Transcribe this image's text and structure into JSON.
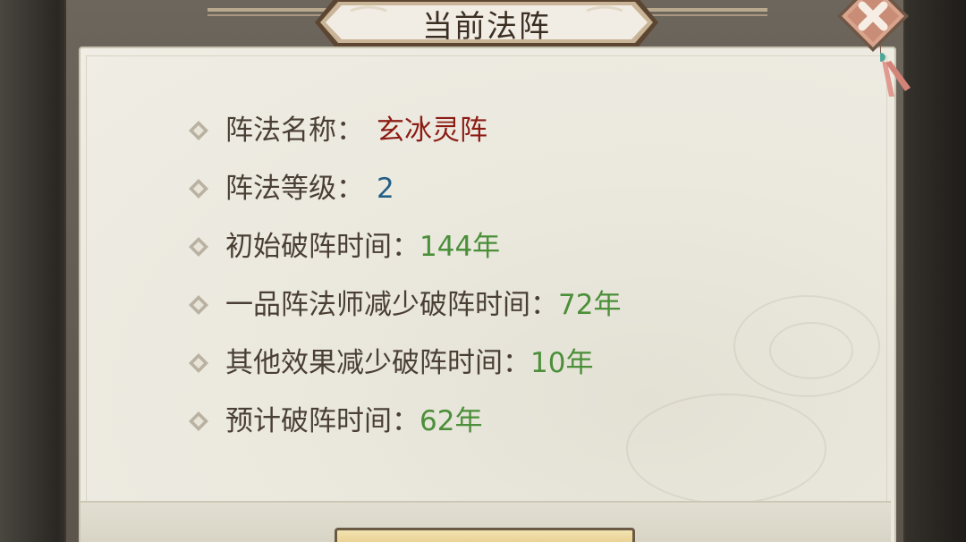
{
  "dialog": {
    "title": "当前法阵",
    "close_icon": "close-icon"
  },
  "info": {
    "formation_name_label": "阵法名称：",
    "formation_name_value": "玄冰灵阵",
    "formation_level_label": "阵法等级：",
    "formation_level_value": "2",
    "initial_break_time_label": "初始破阵时间：",
    "initial_break_time_value": "144年",
    "master_reduction_label": "一品阵法师减少破阵时间：",
    "master_reduction_value": "72年",
    "other_reduction_label": "其他效果减少破阵时间：",
    "other_reduction_value": "10年",
    "estimated_break_time_label": "预计破阵时间：",
    "estimated_break_time_value": "62年"
  },
  "colors": {
    "name_value": "#8c1c14",
    "level_value": "#235f86",
    "time_values": "#4b8f3a",
    "label_text": "#4a3f35",
    "close_button": "#d9a38c"
  }
}
